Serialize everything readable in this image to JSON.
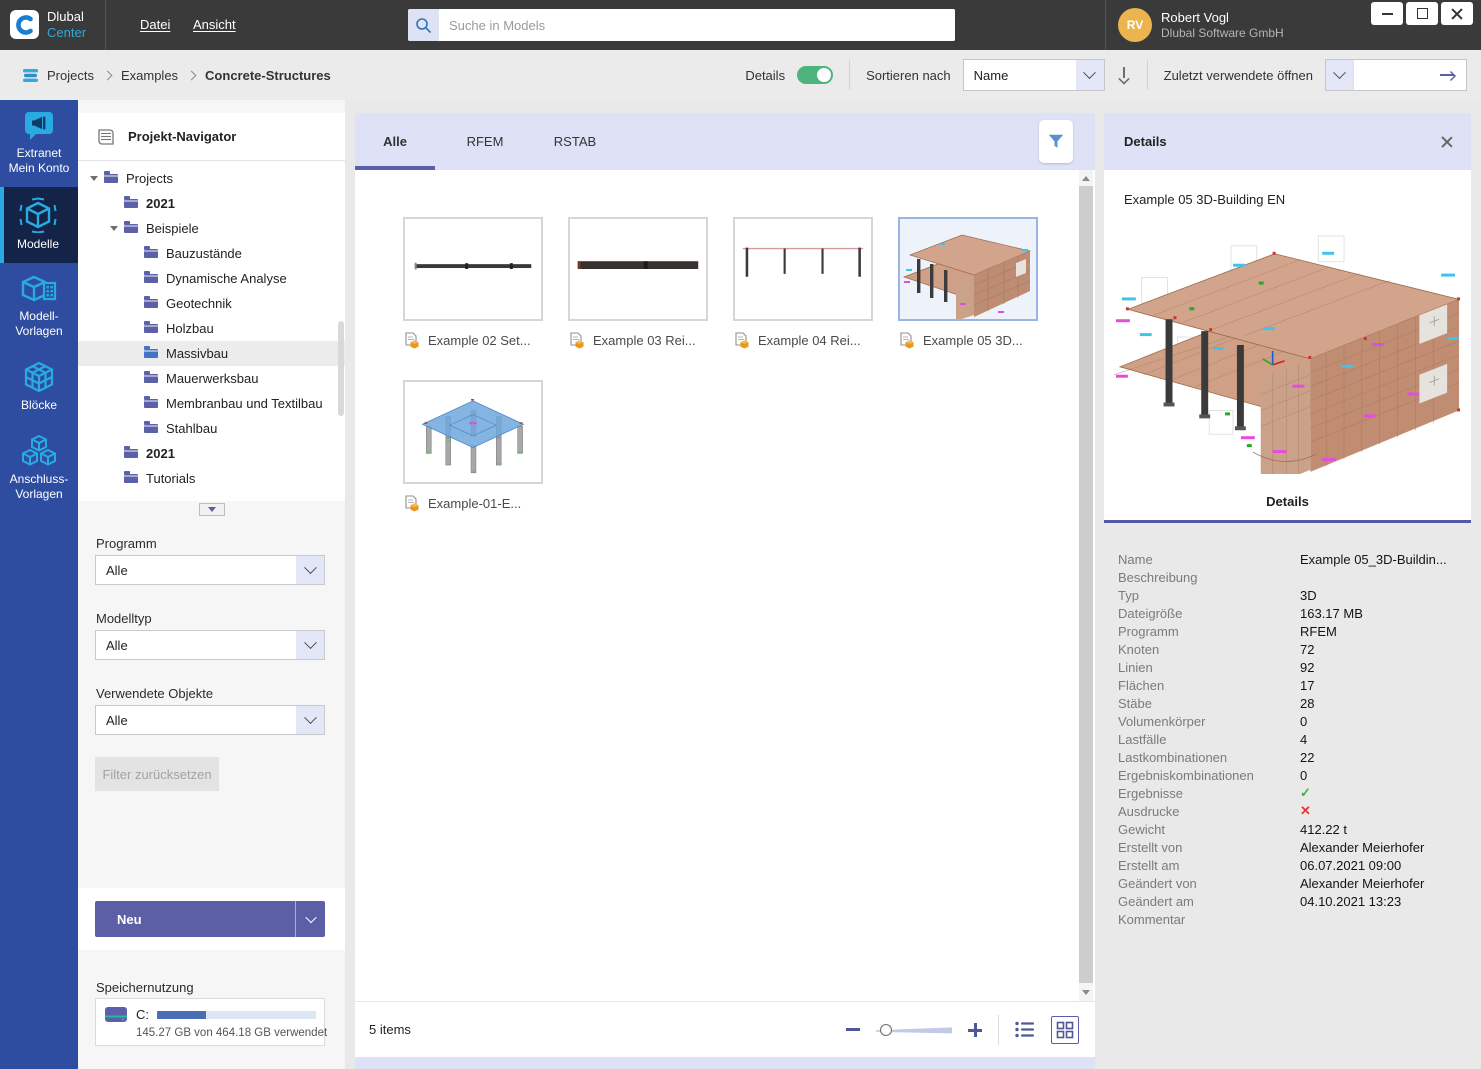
{
  "theme": {
    "titlebar_bg": "#3a3a3a",
    "rail_bg": "#2e4da0",
    "rail_selected_bg": "#132448",
    "icon_cyan": "#29abe2",
    "accent_purple": "#5b5fa5",
    "lavender": "#dfe2f6",
    "toggle_green": "#4db47e",
    "avatar_orange": "#ecb44e",
    "check_green": "#3db33d",
    "cross_red": "#e03a3a"
  },
  "titlebar": {
    "app_name": "Dlubal",
    "app_sub": "Center",
    "menus": [
      {
        "label": "Datei"
      },
      {
        "label": "Ansicht"
      }
    ],
    "search_placeholder": "Suche in Models",
    "user": {
      "initials": "RV",
      "name": "Robert Vogl",
      "org": "Dlubal Software GmbH"
    }
  },
  "toolbar": {
    "breadcrumb": [
      {
        "label": "Projects"
      },
      {
        "label": "Examples"
      },
      {
        "label": "Concrete-Structures"
      }
    ],
    "details_label": "Details",
    "sort_label": "Sortieren nach",
    "sort_value": "Name",
    "recent_label": "Zuletzt verwendete öffnen"
  },
  "sidebar": {
    "items": [
      {
        "line1": "Extranet",
        "line2": "Mein Konto"
      },
      {
        "line1": "Modelle",
        "line2": ""
      },
      {
        "line1": "Modell-",
        "line2": "Vorlagen"
      },
      {
        "line1": "Blöcke",
        "line2": ""
      },
      {
        "line1": "Anschluss-",
        "line2": "Vorlagen"
      }
    ]
  },
  "navigator": {
    "title": "Projekt-Navigator",
    "tree": [
      {
        "label": "Projects"
      },
      {
        "label": "2021"
      },
      {
        "label": "Beispiele"
      },
      {
        "label": "Bauzustände"
      },
      {
        "label": "Dynamische Analyse"
      },
      {
        "label": "Geotechnik"
      },
      {
        "label": "Holzbau"
      },
      {
        "label": "Massivbau"
      },
      {
        "label": "Mauerwerksbau"
      },
      {
        "label": "Membranbau und Textilbau"
      },
      {
        "label": "Stahlbau"
      },
      {
        "label": "2021"
      },
      {
        "label": "Tutorials"
      }
    ]
  },
  "filters": {
    "groups": [
      {
        "label": "Programm",
        "value": "Alle"
      },
      {
        "label": "Modelltyp",
        "value": "Alle"
      },
      {
        "label": "Verwendete Objekte",
        "value": "Alle"
      }
    ],
    "reset_label": "Filter zurücksetzen"
  },
  "actions": {
    "new_label": "Neu"
  },
  "storage": {
    "title": "Speichernutzung",
    "drive": "C:",
    "used_text": "145.27 GB von 464.18 GB verwendet",
    "used_percent": 31
  },
  "content": {
    "tabs": [
      {
        "label": "Alle"
      },
      {
        "label": "RFEM"
      },
      {
        "label": "RSTAB"
      }
    ],
    "cards": [
      {
        "label": "Example 02 Set..."
      },
      {
        "label": "Example 03 Rei..."
      },
      {
        "label": "Example 04 Rei..."
      },
      {
        "label": "Example 05 3D..."
      },
      {
        "label": "Example-01-E..."
      }
    ],
    "status": "5 items"
  },
  "details": {
    "header": "Details",
    "model_title": "Example 05 3D-Building EN",
    "tab_label": "Details",
    "properties": [
      {
        "label": "Name",
        "value": "Example 05_3D-Buildin..."
      },
      {
        "label": "Beschreibung",
        "value": ""
      },
      {
        "label": "Typ",
        "value": "3D"
      },
      {
        "label": "Dateigröße",
        "value": "163.17 MB"
      },
      {
        "label": "Programm",
        "value": "RFEM"
      },
      {
        "label": "Knoten",
        "value": "72"
      },
      {
        "label": "Linien",
        "value": "92"
      },
      {
        "label": "Flächen",
        "value": "17"
      },
      {
        "label": "Stäbe",
        "value": "28"
      },
      {
        "label": "Volumenkörper",
        "value": "0"
      },
      {
        "label": "Lastfälle",
        "value": "4"
      },
      {
        "label": "Lastkombinationen",
        "value": "22"
      },
      {
        "label": "Ergebniskombinationen",
        "value": "0"
      },
      {
        "label": "Ergebnisse",
        "value": "✓"
      },
      {
        "label": "Ausdrucke",
        "value": "✕"
      },
      {
        "label": "Gewicht",
        "value": "412.22 t"
      },
      {
        "label": "Erstellt von",
        "value": "Alexander Meierhofer"
      },
      {
        "label": "Erstellt am",
        "value": "06.07.2021 09:00"
      },
      {
        "label": "Geändert von",
        "value": "Alexander Meierhofer"
      },
      {
        "label": "Geändert am",
        "value": "04.10.2021 13:23"
      },
      {
        "label": "Kommentar",
        "value": ""
      }
    ]
  }
}
